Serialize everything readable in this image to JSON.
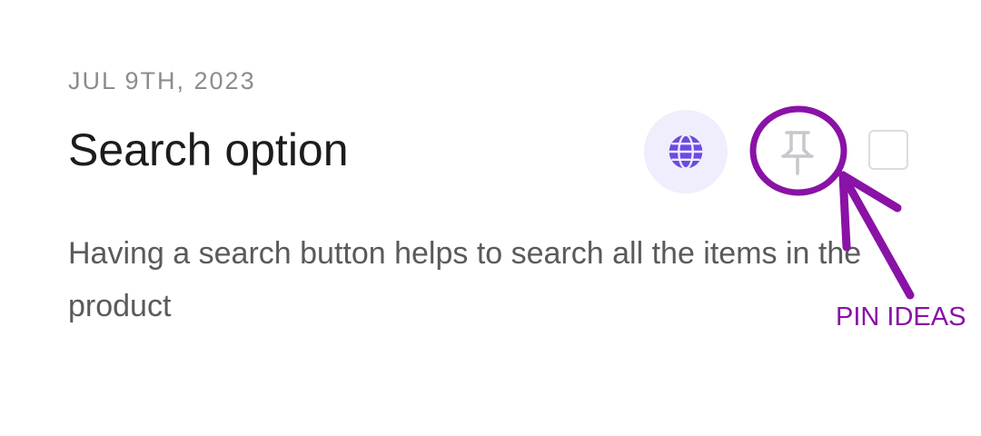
{
  "note": {
    "date": "JUL 9TH, 2023",
    "title": "Search option",
    "description": "Having a search button helps to search all the items in the product"
  },
  "actions": {
    "globe_icon": "globe-icon",
    "pin_icon": "pin-icon",
    "checkbox_checked": false
  },
  "annotation": {
    "label": "PIN IDEAS",
    "color": "#8a12a6"
  },
  "colors": {
    "accent": "#6c4ce0",
    "accent_bg": "#f0eefc",
    "title": "#1c1c1e",
    "muted": "#8c8c8c",
    "body_text": "#5a5a5e"
  }
}
